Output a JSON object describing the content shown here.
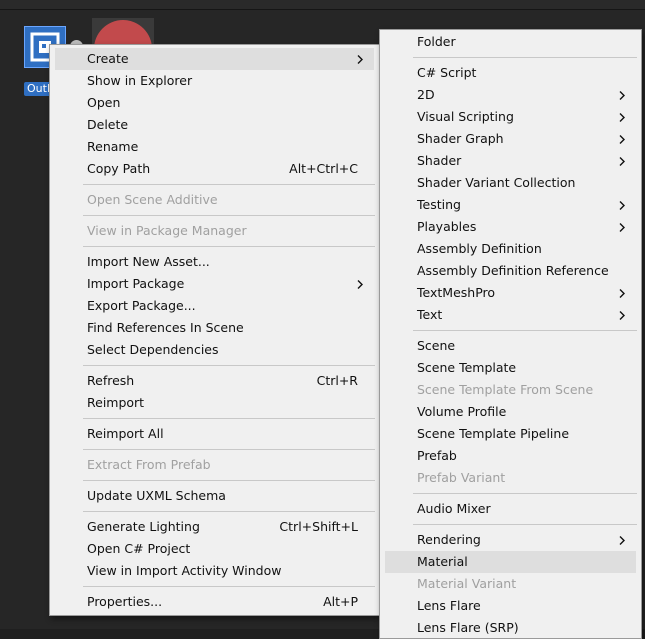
{
  "asset": {
    "label": "OutlineTest"
  },
  "context_menu": {
    "items": [
      {
        "label": "Create",
        "has_submenu": true,
        "highlighted": true
      },
      {
        "label": "Show in Explorer"
      },
      {
        "label": "Open"
      },
      {
        "label": "Delete"
      },
      {
        "label": "Rename"
      },
      {
        "label": "Copy Path",
        "shortcut": "Alt+Ctrl+C"
      },
      {
        "separator": true
      },
      {
        "label": "Open Scene Additive",
        "disabled": true
      },
      {
        "separator": true
      },
      {
        "label": "View in Package Manager",
        "disabled": true
      },
      {
        "separator": true
      },
      {
        "label": "Import New Asset..."
      },
      {
        "label": "Import Package",
        "has_submenu": true
      },
      {
        "label": "Export Package..."
      },
      {
        "label": "Find References In Scene"
      },
      {
        "label": "Select Dependencies"
      },
      {
        "separator": true
      },
      {
        "label": "Refresh",
        "shortcut": "Ctrl+R"
      },
      {
        "label": "Reimport"
      },
      {
        "separator": true
      },
      {
        "label": "Reimport All"
      },
      {
        "separator": true
      },
      {
        "label": "Extract From Prefab",
        "disabled": true
      },
      {
        "separator": true
      },
      {
        "label": "Update UXML Schema"
      },
      {
        "separator": true
      },
      {
        "label": "Generate Lighting",
        "shortcut": "Ctrl+Shift+L"
      },
      {
        "label": "Open C# Project"
      },
      {
        "label": "View in Import Activity Window"
      },
      {
        "separator": true
      },
      {
        "label": "Properties...",
        "shortcut": "Alt+P"
      }
    ]
  },
  "create_submenu": {
    "items": [
      {
        "label": "Folder"
      },
      {
        "separator": true
      },
      {
        "label": "C# Script"
      },
      {
        "label": "2D",
        "has_submenu": true
      },
      {
        "label": "Visual Scripting",
        "has_submenu": true
      },
      {
        "label": "Shader Graph",
        "has_submenu": true
      },
      {
        "label": "Shader",
        "has_submenu": true
      },
      {
        "label": "Shader Variant Collection"
      },
      {
        "label": "Testing",
        "has_submenu": true
      },
      {
        "label": "Playables",
        "has_submenu": true
      },
      {
        "label": "Assembly Definition"
      },
      {
        "label": "Assembly Definition Reference"
      },
      {
        "label": "TextMeshPro",
        "has_submenu": true
      },
      {
        "label": "Text",
        "has_submenu": true
      },
      {
        "separator": true
      },
      {
        "label": "Scene"
      },
      {
        "label": "Scene Template"
      },
      {
        "label": "Scene Template From Scene",
        "disabled": true
      },
      {
        "label": "Volume Profile"
      },
      {
        "label": "Scene Template Pipeline"
      },
      {
        "label": "Prefab"
      },
      {
        "label": "Prefab Variant",
        "disabled": true
      },
      {
        "separator": true
      },
      {
        "label": "Audio Mixer"
      },
      {
        "separator": true
      },
      {
        "label": "Rendering",
        "has_submenu": true
      },
      {
        "label": "Material",
        "highlighted": true
      },
      {
        "label": "Material Variant",
        "disabled": true
      },
      {
        "label": "Lens Flare"
      },
      {
        "label": "Lens Flare (SRP)"
      }
    ]
  }
}
